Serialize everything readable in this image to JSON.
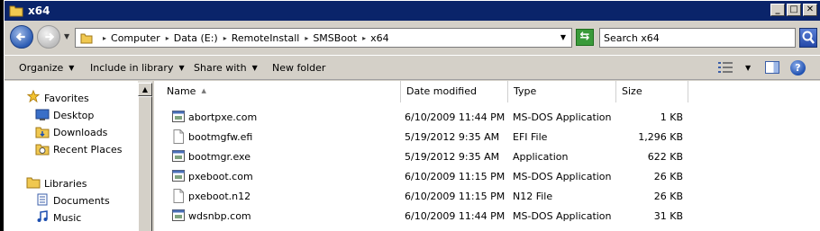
{
  "window": {
    "title": "x64"
  },
  "address": {
    "crumbs": [
      "Computer",
      "Data (E:)",
      "RemoteInstall",
      "SMSBoot",
      "x64"
    ]
  },
  "search": {
    "placeholder": "Search x64"
  },
  "toolbar": {
    "organize": "Organize",
    "include_in_library": "Include in library",
    "share_with": "Share with",
    "new_folder": "New folder"
  },
  "nav": {
    "favorites": "Favorites",
    "desktop": "Desktop",
    "downloads": "Downloads",
    "recent_places": "Recent Places",
    "libraries": "Libraries",
    "documents": "Documents",
    "music": "Music"
  },
  "columns": {
    "name": "Name",
    "date_modified": "Date modified",
    "type": "Type",
    "size": "Size"
  },
  "files": [
    {
      "name": "abortpxe.com",
      "date": "6/10/2009 11:44 PM",
      "type": "MS-DOS Application",
      "size": "1 KB",
      "icon": "app-icon"
    },
    {
      "name": "bootmgfw.efi",
      "date": "5/19/2012 9:35 AM",
      "type": "EFI File",
      "size": "1,296 KB",
      "icon": "file-icon"
    },
    {
      "name": "bootmgr.exe",
      "date": "5/19/2012 9:35 AM",
      "type": "Application",
      "size": "622 KB",
      "icon": "app-icon"
    },
    {
      "name": "pxeboot.com",
      "date": "6/10/2009 11:15 PM",
      "type": "MS-DOS Application",
      "size": "26 KB",
      "icon": "app-icon"
    },
    {
      "name": "pxeboot.n12",
      "date": "6/10/2009 11:15 PM",
      "type": "N12 File",
      "size": "26 KB",
      "icon": "file-icon"
    },
    {
      "name": "wdsnbp.com",
      "date": "6/10/2009 11:44 PM",
      "type": "MS-DOS Application",
      "size": "31 KB",
      "icon": "app-icon"
    }
  ]
}
